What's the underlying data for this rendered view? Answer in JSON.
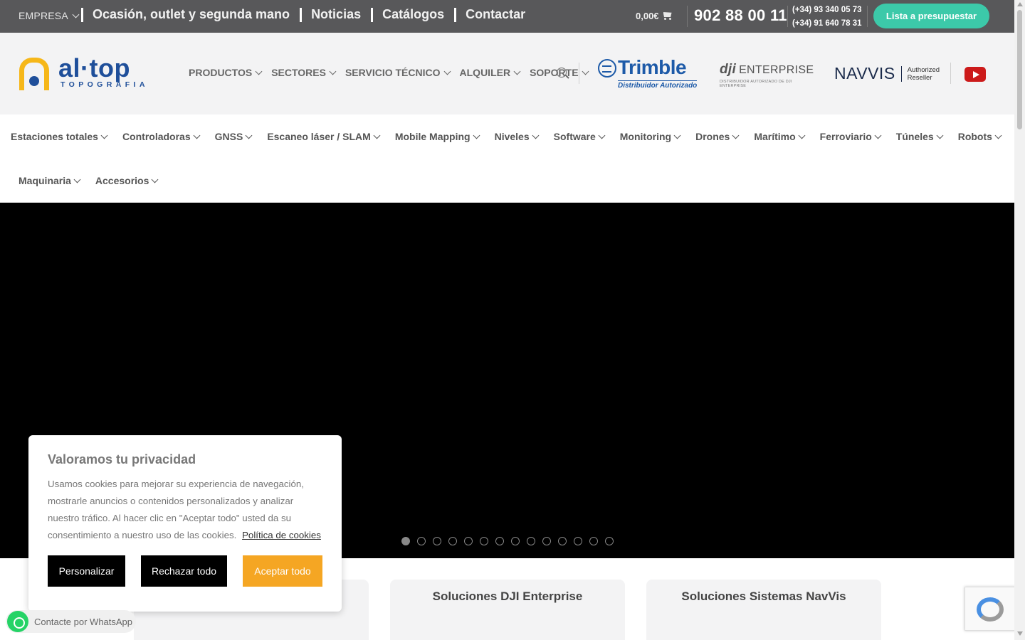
{
  "topbar": {
    "empresa": "EMPRESA",
    "links": [
      "Ocasión, outlet y segunda mano",
      "Noticias",
      "Catálogos",
      "Contactar"
    ],
    "cart_total": "0,00€",
    "phone_main": "902 88 00 11",
    "phone_1": "(+34) 93 340 05 73",
    "phone_2": "(+34) 91 640 78 31",
    "quote_button": "Lista a presupuestar"
  },
  "header": {
    "logo_name": "al·top",
    "logo_sub": "TOPOGRAFIA",
    "nav": [
      "PRODUCTOS",
      "SECTORES",
      "SERVICIO TÉCNICO",
      "ALQUILER",
      "SOPORTE"
    ],
    "trimble_name": "Trimble",
    "trimble_sub": "Distribuidor Autorizado",
    "dji_brand": "dji",
    "dji_name": "ENTERPRISE",
    "dji_sub": "DISTRIBUIDOR AUTORIZADO DE DJI ENTERPRISE",
    "navvis_name": "NAVVIS",
    "navvis_sub_1": "Authorized",
    "navvis_sub_2": "Reseller"
  },
  "categories": {
    "row1": [
      "Estaciones totales",
      "Controladoras",
      "GNSS",
      "Escaneo láser / SLAM",
      "Mobile Mapping",
      "Niveles",
      "Software",
      "Monitoring",
      "Drones",
      "Marítimo",
      "Ferroviario",
      "Túneles",
      "Robots"
    ],
    "row2": [
      "Maquinaria",
      "Accesorios"
    ]
  },
  "slider": {
    "slide_count": 14,
    "active_slide": 1
  },
  "cards": [
    "Soluciones DJI Enterprise",
    "Soluciones Sistemas NavVis"
  ],
  "cookie": {
    "title": "Valoramos tu privacidad",
    "text": "Usamos cookies para mejorar su experiencia de navegación, mostrarle anuncios o contenidos personalizados y analizar nuestro tráfico. Al hacer clic en \"Aceptar todo\" usted da su consentimiento a nuestro uso de las cookies.",
    "link": "Política de cookies",
    "btn_customize": "Personalizar",
    "btn_reject": "Rechazar todo",
    "btn_accept": "Aceptar todo"
  },
  "whatsapp": "Contacte por WhatsApp",
  "colors": {
    "topbar": "#58585a",
    "accent_green": "#3cc9a9",
    "brand_blue": "#1f4f9a",
    "brand_yellow": "#f6b719",
    "accept_orange": "#f5a623"
  }
}
